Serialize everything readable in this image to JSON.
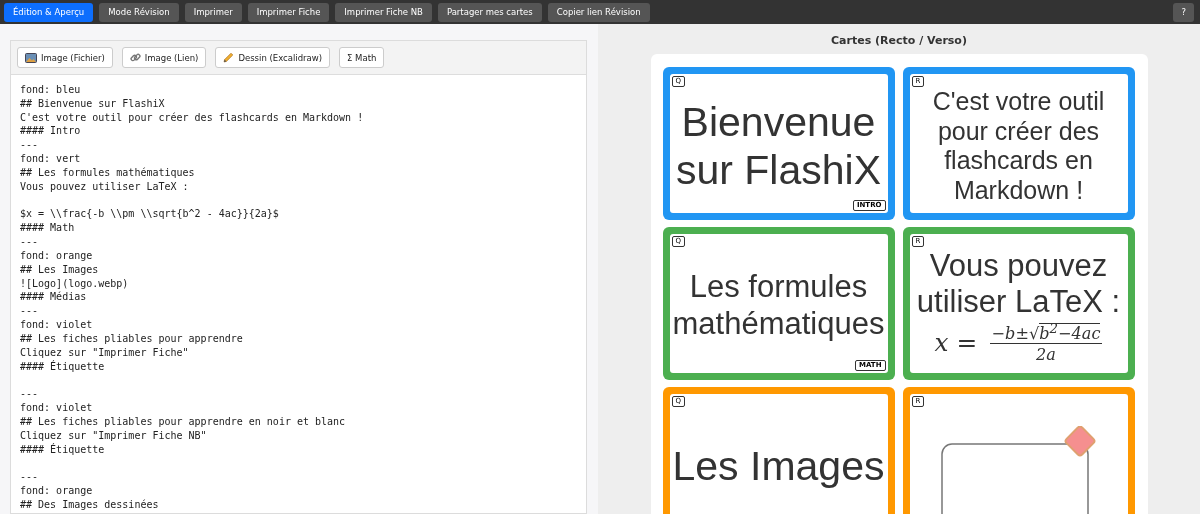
{
  "top_bar": {
    "buttons": [
      {
        "label": "Édition & Aperçu",
        "selected": true
      },
      {
        "label": "Mode Révision",
        "selected": false
      },
      {
        "label": "Imprimer",
        "selected": false
      },
      {
        "label": "Imprimer Fiche",
        "selected": false
      },
      {
        "label": "Imprimer Fiche NB",
        "selected": false
      },
      {
        "label": "Partager mes cartes",
        "selected": false
      },
      {
        "label": "Copier lien Révision",
        "selected": false
      }
    ],
    "help_button": "?"
  },
  "editor": {
    "toolbar": [
      {
        "kind": "image",
        "label": "Image (Fichier)"
      },
      {
        "kind": "link",
        "label": "Image (Lien)"
      },
      {
        "kind": "pencil",
        "label": "Dessin (Excalidraw)"
      },
      {
        "kind": "plain",
        "label": "Σ Math"
      }
    ],
    "value": "fond: bleu\n## Bienvenue sur FlashiX\nC'est votre outil pour créer des flashcards en Markdown !\n#### Intro\n---\nfond: vert\n## Les formules mathématiques\nVous pouvez utiliser LaTeX :\n\n$x = \\\\frac{-b \\\\pm \\\\sqrt{b^2 - 4ac}}{2a}$\n#### Math\n---\nfond: orange\n## Les Images\n![Logo](logo.webp)\n#### Médias\n---\nfond: violet\n## Les fiches pliables pour apprendre\nCliquez sur \"Imprimer Fiche\"\n#### Étiquette\n\n---\nfond: violet\n## Les fiches pliables pour apprendre en noir et blanc\nCliquez sur \"Imprimer Fiche NB\"\n#### Étiquette\n\n---\nfond: orange\n## Des Images dessinées"
  },
  "preview": {
    "title": "Cartes (Recto / Verso)",
    "cards": [
      {
        "badge": "Q",
        "color": "#2196f3",
        "tag": "INTRO",
        "content": [
          {
            "kind": "text",
            "text": "Bienvenue sur FlashiX"
          }
        ]
      },
      {
        "badge": "R",
        "color": "#2196f3",
        "content": [
          {
            "kind": "text",
            "text": "C'est votre outil pour créer des flashcards en Markdown !"
          }
        ]
      },
      {
        "badge": "Q",
        "color": "#4caf50",
        "tag": "MATH",
        "content": [
          {
            "kind": "text",
            "text": "Les formules mathématiques"
          }
        ]
      },
      {
        "badge": "R",
        "color": "#4caf50",
        "content": [
          {
            "kind": "text",
            "text": "Vous pouvez utiliser LaTeX :"
          },
          {
            "kind": "math",
            "lhs": "x =",
            "numerator_prefix": "−b±√",
            "radicand": "b$^{2}$−4ac",
            "denominator": "2a"
          }
        ]
      },
      {
        "badge": "Q",
        "color": "#ff9800",
        "content": [
          {
            "kind": "text",
            "text": "Les Images"
          }
        ]
      },
      {
        "badge": "R",
        "color": "#ff9800",
        "content": [
          {
            "kind": "image"
          }
        ]
      }
    ]
  }
}
